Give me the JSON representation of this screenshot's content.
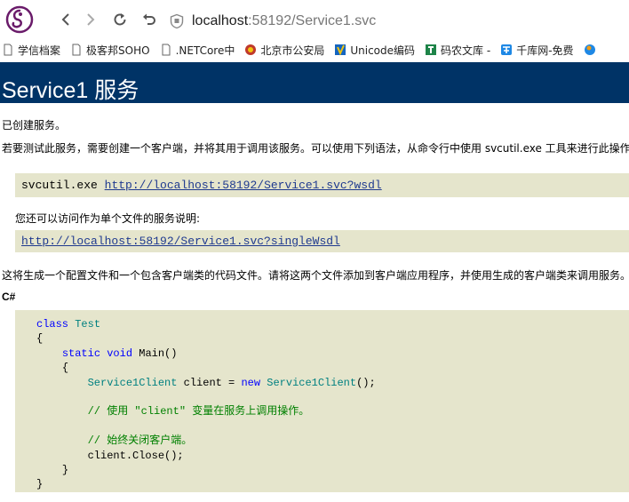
{
  "browser": {
    "url_host": "localhost",
    "url_rest": ":58192/Service1.svc"
  },
  "bookmarks": [
    {
      "label": "学信档案",
      "icon": "page-icon"
    },
    {
      "label": "极客邦SOHO",
      "icon": "page-icon"
    },
    {
      "label": ".NETCore中",
      "icon": "page-icon"
    },
    {
      "label": "北京市公安局",
      "icon": "police-badge-icon"
    },
    {
      "label": "Unicode编码",
      "icon": "unicode-icon"
    },
    {
      "label": "码农文库 -",
      "icon": "book-icon"
    },
    {
      "label": "千库网-免费",
      "icon": "qianku-icon"
    }
  ],
  "page": {
    "title": "Service1 服务",
    "intro": "已创建服务。",
    "instructions": "若要测试此服务，需要创建一个客户端，并将其用于调用该服务。可以使用下列语法，从命令行中使用 svcutil.exe 工具来进行此操作",
    "svcutil_cmd": "svcutil.exe",
    "wsdl_link": "http://localhost:58192/Service1.svc?wsdl",
    "single_file_note": "您还可以访问作为单个文件的服务说明:",
    "single_wsdl_link": "http://localhost:58192/Service1.svc?singleWsdl",
    "generate_note": "这将生成一个配置文件和一个包含客户端类的代码文件。请将这两个文件添加到客户端应用程序，并使用生成的客户端类来调用服务。",
    "language_label": "C#"
  },
  "code": {
    "kw_class": "class",
    "class_name": "Test",
    "brace_open": "{",
    "kw_static": "static",
    "kw_void": "void",
    "method": "Main()",
    "inner_brace_open": "{",
    "client_type": "Service1Client",
    "client_var": " client = ",
    "kw_new": "new",
    "client_ctor": "Service1Client",
    "ctor_end": "();",
    "comment_use": "// 使用 \"client\" 变量在服务上调用操作。",
    "comment_close": "// 始终关闭客户端。",
    "close_call": "client.Close();",
    "inner_brace_close": "}",
    "brace_close": "}"
  },
  "colors": {
    "header_bg": "#003366",
    "code_bg": "#e5e5cc",
    "keyword": "#0000ff",
    "type": "#008080",
    "comment": "#008000"
  }
}
